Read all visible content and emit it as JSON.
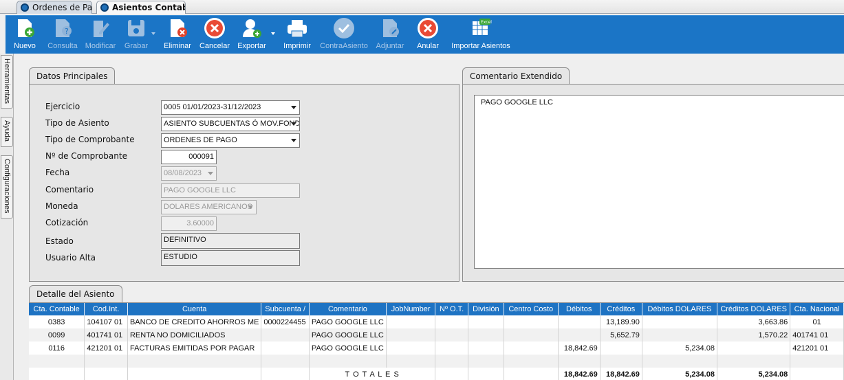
{
  "tabs": [
    {
      "label": "Ordenes de Pago"
    },
    {
      "label": "Asientos Contables"
    }
  ],
  "toolbar": {
    "items": [
      {
        "label": "Nuevo",
        "icon": "new-doc-icon",
        "enabled": true
      },
      {
        "label": "Consulta",
        "icon": "query-icon",
        "enabled": false
      },
      {
        "label": "Modificar",
        "icon": "edit-icon",
        "enabled": false
      },
      {
        "label": "Grabar",
        "icon": "save-icon",
        "enabled": false
      },
      {
        "label": "Eliminar",
        "icon": "delete-icon",
        "enabled": true
      },
      {
        "label": "Cancelar",
        "icon": "cancel-icon",
        "enabled": true
      },
      {
        "label": "Exportar",
        "icon": "export-icon",
        "enabled": true
      },
      {
        "label": "Imprimir",
        "icon": "printer-icon",
        "enabled": true
      },
      {
        "label": "ContraAsiento",
        "icon": "check-icon",
        "enabled": false
      },
      {
        "label": "Adjuntar",
        "icon": "attach-icon",
        "enabled": false
      },
      {
        "label": "Anular",
        "icon": "void-icon",
        "enabled": true
      },
      {
        "label": "Importar Asientos",
        "icon": "excel-icon",
        "enabled": true
      }
    ]
  },
  "sidebar": {
    "tabs": [
      "Herramientas",
      "Ayuda",
      "Configuraciones"
    ]
  },
  "datos": {
    "title": "Datos Principales",
    "ejercicio_label": "Ejercicio",
    "ejercicio": "0005 01/01/2023-31/12/2023",
    "tipo_asiento_label": "Tipo de Asiento",
    "tipo_asiento": "ASIENTO SUBCUENTAS Ó MOV.FONDOS",
    "tipo_comprobante_label": "Tipo de Comprobante",
    "tipo_comprobante": "ORDENES DE PAGO",
    "nro_comprobante_label": "Nº de Comprobante",
    "nro_comprobante": "000091",
    "fecha_label": "Fecha",
    "fecha": "08/08/2023",
    "comentario_label": "Comentario",
    "comentario": "PAGO GOOGLE LLC",
    "moneda_label": "Moneda",
    "moneda": "DOLARES AMERICANOS",
    "cotizacion_label": "Cotización",
    "cotizacion": "3.60000",
    "estado_label": "Estado",
    "estado": "DEFINITIVO",
    "usuario_label": "Usuario Alta",
    "usuario": "ESTUDIO"
  },
  "comentario_ext": {
    "title": "Comentario Extendido",
    "text": "PAGO GOOGLE LLC"
  },
  "detalle": {
    "title": "Detalle del Asiento",
    "columns": [
      "Cta. Contable",
      "Cod.Int.",
      "Cuenta",
      "Subcuenta /",
      "Comentario",
      "JobNumber",
      "Nº O.T.",
      "División",
      "Centro Costo",
      "Débitos",
      "Créditos",
      "Débitos DOLARES",
      "Créditos DOLARES",
      "Cta. Nacional"
    ],
    "rows": [
      [
        "0383",
        "104107 01",
        "BANCO DE CREDITO AHORROS ME",
        "0000224455",
        "PAGO GOOGLE LLC",
        "",
        "",
        "",
        "",
        "",
        "13,189.90",
        "",
        "3,663.86",
        "01"
      ],
      [
        "0099",
        "401741 01",
        "RENTA NO DOMICILIADOS",
        "",
        "PAGO GOOGLE LLC",
        "",
        "",
        "",
        "",
        "",
        "5,652.79",
        "",
        "1,570.22",
        "401741  01"
      ],
      [
        "0116",
        "421201 01",
        "FACTURAS EMITIDAS POR PAGAR",
        "",
        "PAGO GOOGLE LLC",
        "",
        "",
        "",
        "",
        "18,842.69",
        "",
        "5,234.08",
        "",
        "421201  01"
      ]
    ],
    "totals_label": "T O T A L E S",
    "totals": {
      "debitos": "18,842.69",
      "creditos": "18,842.69",
      "debitos_usd": "5,234.08",
      "creditos_usd": "5,234.08"
    }
  }
}
